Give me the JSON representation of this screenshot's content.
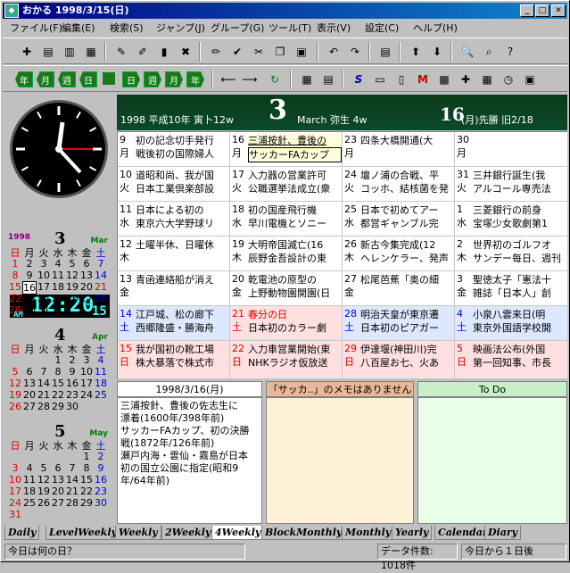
{
  "window": {
    "title": "おかる  1998/3/15(日)",
    "min": "_",
    "max": "□",
    "close": "✕"
  },
  "menu": [
    "ファイル(F)",
    "編集(E)",
    "検索(S)",
    "ジャンプ(J)",
    "グループ(G)",
    "ツール(T)",
    "表示(V)",
    "設定(C)",
    "ヘルプ(H)"
  ],
  "nav_labels": [
    "年",
    "月",
    "週",
    "日",
    "日",
    "週",
    "月",
    "年"
  ],
  "header": {
    "left": "1998 平成10年 寅卜12w",
    "month_num": "3",
    "month_en": "March 弥生 4w",
    "day_num": "16",
    "day_info": "(月)先勝 旧2/18"
  },
  "clock": {
    "ampm": "AM",
    "time": "12:20",
    "sec": "15"
  },
  "mini_cals": [
    {
      "year": "1998",
      "month": "3",
      "month_en": "Mar",
      "weekdays": [
        "日",
        "月",
        "火",
        "水",
        "木",
        "金",
        "土"
      ],
      "rows": [
        [
          "1",
          "2",
          "3",
          "4",
          "5",
          "6",
          "7"
        ],
        [
          "8",
          "9",
          "10",
          "11",
          "12",
          "13",
          "14"
        ],
        [
          "15",
          "16",
          "17",
          "18",
          "19",
          "20",
          "21"
        ],
        [
          "22",
          "23",
          "24",
          "25",
          "26",
          "27",
          "28"
        ],
        [
          "29",
          "30",
          "31",
          "",
          "",
          "",
          ""
        ]
      ]
    },
    {
      "year": "",
      "month": "4",
      "month_en": "Apr",
      "weekdays": [
        "日",
        "月",
        "火",
        "水",
        "木",
        "金",
        "土"
      ],
      "rows": [
        [
          "",
          "",
          "",
          "1",
          "2",
          "3",
          "4"
        ],
        [
          "5",
          "6",
          "7",
          "8",
          "9",
          "10",
          "11"
        ],
        [
          "12",
          "13",
          "14",
          "15",
          "16",
          "17",
          "18"
        ],
        [
          "19",
          "20",
          "21",
          "22",
          "23",
          "24",
          "25"
        ],
        [
          "26",
          "27",
          "28",
          "29",
          "30",
          "",
          ""
        ]
      ]
    },
    {
      "year": "",
      "month": "5",
      "month_en": "May",
      "weekdays": [
        "日",
        "月",
        "火",
        "水",
        "木",
        "金",
        "土"
      ],
      "rows": [
        [
          "",
          "",
          "",
          "",
          "",
          "1",
          "2"
        ],
        [
          "3",
          "4",
          "5",
          "6",
          "7",
          "8",
          "9"
        ],
        [
          "10",
          "11",
          "12",
          "13",
          "14",
          "15",
          "16"
        ],
        [
          "17",
          "18",
          "19",
          "20",
          "21",
          "22",
          "23"
        ],
        [
          "24",
          "25",
          "26",
          "27",
          "28",
          "29",
          "30"
        ],
        [
          "31",
          "",
          "",
          "",
          "",
          "",
          ""
        ]
      ]
    }
  ],
  "grid": [
    [
      {
        "d": "9",
        "w": "月",
        "t": "",
        "e": [
          "初の記念切手発行",
          "戦後初の国際婦人"
        ]
      },
      {
        "d": "16",
        "w": "月",
        "t": "sel",
        "e": [
          "三浦按針、豊後の",
          "サッカーFAカップ"
        ]
      },
      {
        "d": "23",
        "w": "月",
        "t": "",
        "e": [
          "四条大橋開通(大",
          ""
        ]
      },
      {
        "d": "30",
        "w": "月",
        "t": "",
        "e": [
          "",
          ""
        ]
      }
    ],
    [
      {
        "d": "10",
        "w": "火",
        "t": "",
        "e": [
          "道昭和尚、我が国",
          "日本工業倶楽部設"
        ]
      },
      {
        "d": "17",
        "w": "火",
        "t": "",
        "e": [
          "入力器の営業許可",
          "公職選挙法成立(衆"
        ]
      },
      {
        "d": "24",
        "w": "火",
        "t": "",
        "e": [
          "壇ノ浦の合戦、平",
          "コッホ、結核菌を発"
        ]
      },
      {
        "d": "31",
        "w": "火",
        "t": "",
        "e": [
          "三井銀行誕生(我",
          "アルコール専売法"
        ]
      }
    ],
    [
      {
        "d": "11",
        "w": "水",
        "t": "",
        "e": [
          "日本による初の",
          "東京六大学野球リ"
        ]
      },
      {
        "d": "18",
        "w": "水",
        "t": "",
        "e": [
          "初の国産飛行機",
          "早川電機とソニー"
        ]
      },
      {
        "d": "25",
        "w": "水",
        "t": "",
        "e": [
          "日本で初めてアー",
          "都営ギャンブル完"
        ]
      },
      {
        "d": "1",
        "w": "水",
        "t": "",
        "e": [
          "三菱銀行の前身",
          "宝塚少女歌劇第1"
        ]
      }
    ],
    [
      {
        "d": "12",
        "w": "木",
        "t": "",
        "e": [
          "土曜半休、日曜休",
          ""
        ]
      },
      {
        "d": "19",
        "w": "木",
        "t": "",
        "e": [
          "大明帝国滅亡(16",
          "辰野金吾設計の東"
        ]
      },
      {
        "d": "26",
        "w": "木",
        "t": "",
        "e": [
          "新古今集完成(12",
          "ヘレンケラー、発声"
        ]
      },
      {
        "d": "2",
        "w": "木",
        "t": "",
        "e": [
          "世界初のゴルフオ",
          "サンデー毎日、週刊"
        ]
      }
    ],
    [
      {
        "d": "13",
        "w": "金",
        "t": "",
        "e": [
          "青函連絡船が消え",
          ""
        ]
      },
      {
        "d": "20",
        "w": "金",
        "t": "",
        "e": [
          "乾電池の原型の",
          "上野動物園開園(日"
        ]
      },
      {
        "d": "27",
        "w": "金",
        "t": "",
        "e": [
          "松尾芭蕉「奥の細",
          ""
        ]
      },
      {
        "d": "3",
        "w": "金",
        "t": "",
        "e": [
          "聖徳太子「憲法十",
          "雑誌「日本人」創"
        ]
      }
    ],
    [
      {
        "d": "14",
        "w": "土",
        "t": "sat",
        "e": [
          "江戸城、松の廊下",
          "西郷隆盛・勝海舟"
        ]
      },
      {
        "d": "21",
        "w": "土",
        "t": "sun",
        "e": [
          "春分の日",
          "日本初のカラー劇"
        ]
      },
      {
        "d": "28",
        "w": "土",
        "t": "sat",
        "e": [
          "明治天皇が東京遷",
          "日本初のピアガー"
        ]
      },
      {
        "d": "4",
        "w": "土",
        "t": "sat",
        "e": [
          "小泉八雲来日(明",
          "東京外国語学校開"
        ]
      }
    ],
    [
      {
        "d": "15",
        "w": "日",
        "t": "sun",
        "e": [
          "我が国初の靴工場",
          "株大暴落で株式市"
        ]
      },
      {
        "d": "22",
        "w": "日",
        "t": "sun",
        "e": [
          "入力車営業開始(東",
          "NHKラジオ仮放送"
        ]
      },
      {
        "d": "29",
        "w": "日",
        "t": "sun",
        "e": [
          "伊達堰(神田川)完",
          "八百屋お七、火あ"
        ]
      },
      {
        "d": "5",
        "w": "日",
        "t": "sun",
        "e": [
          "映画法公布(外国",
          "第一回知事、市長"
        ]
      }
    ]
  ],
  "memo": {
    "date": "1998/3/16(月)",
    "text": [
      "三浦按針、豊後の佐志生に",
      "漂着(1600年/398年前)",
      "サッカーFAカップ、初の決勝",
      "戦(1872年/126年前)",
      "瀬戸内海・雲仙・霧島が日本",
      "初の国立公園に指定(昭和9",
      "年/64年前)"
    ],
    "note_header": "「サッカ..」のメモはありません",
    "todo_header": "To Do"
  },
  "tabs": [
    "Daily",
    "LevelWeekly",
    "Weekly",
    "2Weekly",
    "4Weekly",
    "BlockMonthly",
    "Monthly",
    "Yearly",
    "Calendar",
    "Diary"
  ],
  "active_tab": "4Weekly",
  "status": {
    "hint": "今日は何の日？",
    "count": "データ件数: 1018件",
    "days": "今日から１日後"
  }
}
